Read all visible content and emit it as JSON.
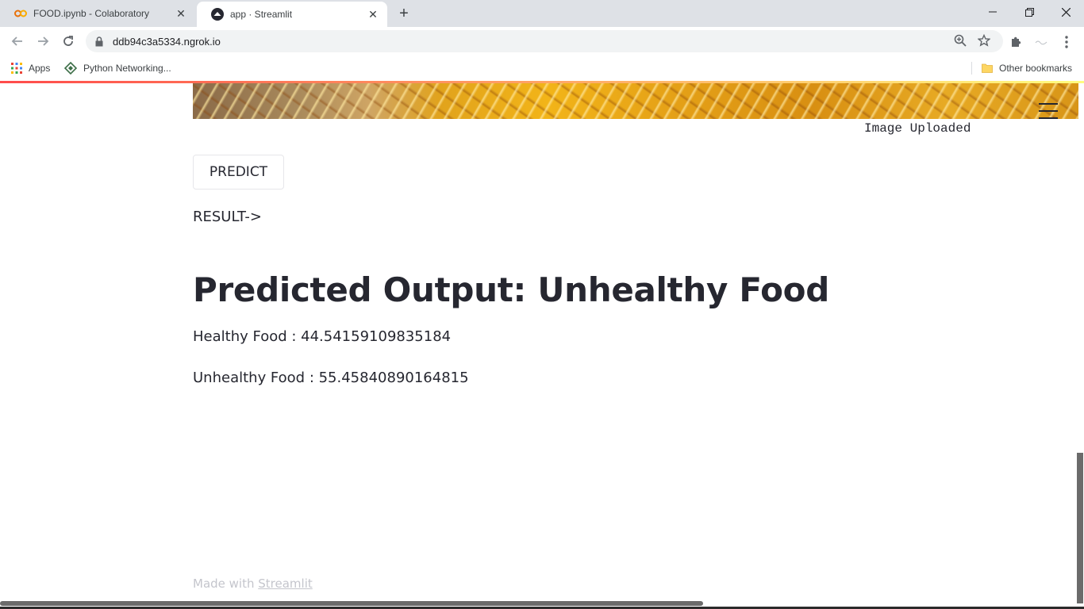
{
  "browser": {
    "tabs": [
      {
        "title": "FOOD.ipynb - Colaboratory",
        "icon": "colab-icon",
        "active": false
      },
      {
        "title": "app · Streamlit",
        "icon": "streamlit-icon",
        "active": true
      }
    ],
    "url": "ddb94c3a5334.ngrok.io",
    "bookmarks": {
      "apps_label": "Apps",
      "item1": "Python Networking...",
      "other": "Other bookmarks"
    }
  },
  "app": {
    "image_caption": "Image Uploaded",
    "predict_button": "PREDICT",
    "result_label": "RESULT->",
    "heading": "Predicted Output: Unhealthy Food",
    "healthy_text": "Healthy Food : 44.54159109835184",
    "unhealthy_text": "Unhealthy Food : 55.45840890164815",
    "footer_prefix": "Made with ",
    "footer_link": "Streamlit"
  },
  "colors": {
    "text": "#262730",
    "accent": "#ff4b4b",
    "footer": "#c4c5cc"
  }
}
